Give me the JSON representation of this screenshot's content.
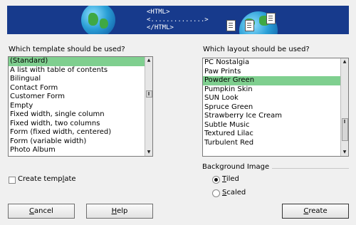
{
  "banner": {
    "code_lines": [
      "<HTML>",
      "<..............>",
      "</HTML>"
    ]
  },
  "template": {
    "label": "Which template should be used?",
    "items": [
      "(Standard)",
      "A list with table of contents",
      "Bilingual",
      "Contact Form",
      "Customer Form",
      "Empty",
      "Fixed width, single column",
      "Fixed width, two columns",
      "Form (fixed width, centered)",
      "Form (variable width)",
      "Photo Album"
    ],
    "selected": 0
  },
  "layout": {
    "label": "Which layout should be used?",
    "items": [
      "PC Nostalgia",
      "Paw Prints",
      "Powder Green",
      "Pumpkin Skin",
      "SUN Look",
      "Spruce Green",
      "Strawberry Ice Cream",
      "Subtle Music",
      "Textured Lilac",
      "Turbulent Red"
    ],
    "selected": 2
  },
  "create_template": {
    "label_pre": "Create temp",
    "label_ul": "l",
    "label_post": "ate",
    "checked": false
  },
  "background_image": {
    "title": "Background Image",
    "tiled": {
      "ul": "T",
      "rest": "iled",
      "checked": true
    },
    "scaled": {
      "ul": "S",
      "rest": "caled",
      "checked": false
    }
  },
  "buttons": {
    "cancel": {
      "ul": "C",
      "rest": "ancel"
    },
    "help": {
      "ul": "H",
      "rest": "elp"
    },
    "create": {
      "ul": "C",
      "rest": "reate"
    }
  },
  "colors": {
    "banner": "#173a8c",
    "selection": "#7fcf8f"
  }
}
